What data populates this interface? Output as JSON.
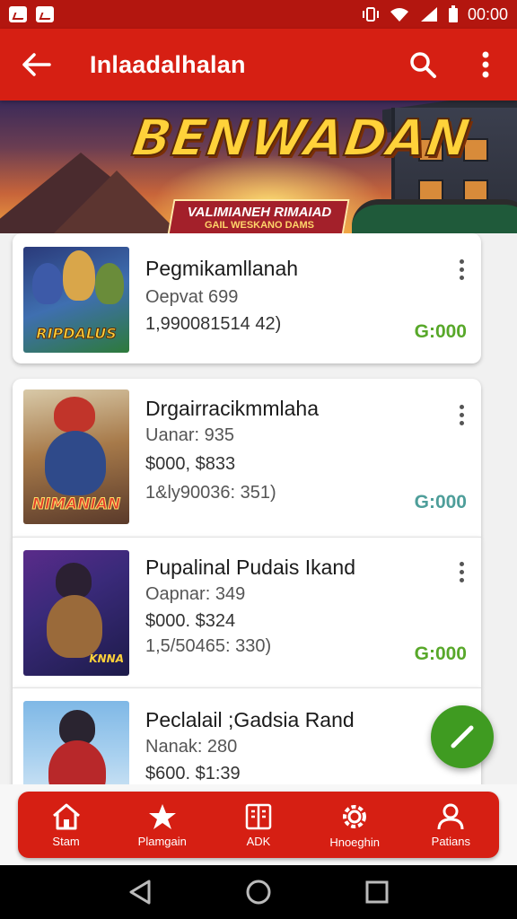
{
  "status_bar": {
    "time": "00:00"
  },
  "app_bar": {
    "title": "Inlaadalhalan"
  },
  "banner": {
    "title": "BENWADAN",
    "subtitle": "VALIMIANEH RIMAIAD",
    "subtitle2": "GAIL WESKANO DAMS"
  },
  "items": [
    {
      "title": "Pegmikamllanah",
      "line1": "Oepvat 699",
      "line2": "1,990081514 42)",
      "line3": "",
      "price": "G:000",
      "thumb_text": "RIPDALUS",
      "price_color": "#58a82a"
    },
    {
      "title": "Drgairracikmmlaha",
      "line1": "Uanar: 935",
      "line2": "$000, $833",
      "line3": "1&ly90036: 351)",
      "price": "G:000",
      "thumb_text": "NIMANIAN",
      "price_color": "#4e9e9a"
    },
    {
      "title": "Pupalinal Pudais Ikand",
      "line1": "Oapnar: 349",
      "line2": "$000. $324",
      "line3": "1,5/50465: 330)",
      "price": "G:000",
      "thumb_text": "KNNA",
      "price_color": "#58a82a"
    },
    {
      "title": "Peclalail ;Gadsia Rand",
      "line1": "Nanak: 280",
      "line2": "$600. $1:39",
      "line3": "",
      "price": "",
      "thumb_text": "",
      "price_color": "#58a82a"
    }
  ],
  "bottom_nav": [
    {
      "label": "Stam",
      "icon": "home-icon"
    },
    {
      "label": "Plamgain",
      "icon": "star-icon"
    },
    {
      "label": "ADK",
      "icon": "book-icon"
    },
    {
      "label": "Hnoeghin",
      "icon": "gear-icon"
    },
    {
      "label": "Patians",
      "icon": "person-icon"
    }
  ],
  "colors": {
    "primary": "#d61f13",
    "status_bar": "#b3160f",
    "fab": "#3f9b21",
    "price_green": "#58a82a",
    "price_teal": "#4e9e9a"
  }
}
